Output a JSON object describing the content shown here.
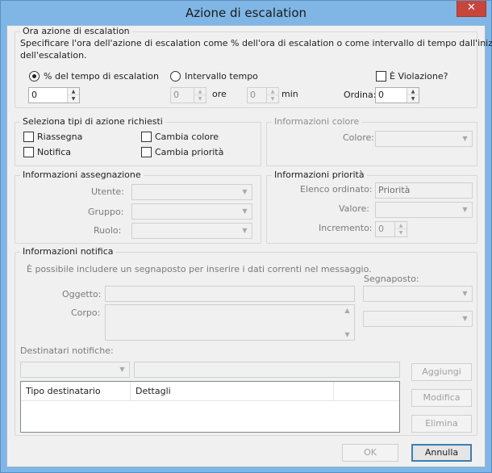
{
  "window": {
    "title": "Azione di escalation",
    "close_glyph": "✕"
  },
  "escalation_time": {
    "group_title": "Ora azione di escalation",
    "description_line1": "Specificare l'ora dell'azione di escalation come % dell'ora di escalation o come intervallo di tempo dall'inizio",
    "description_line2": "dell'escalation.",
    "percent_option": "% del tempo di escalation",
    "interval_option": "Intervallo tempo",
    "percent_value": "0",
    "hours_value": "0",
    "hours_unit": "ore",
    "minutes_value": "0",
    "minutes_unit": "min",
    "violation_label": "È Violazione?",
    "order_label": "Ordina:",
    "order_value": "0"
  },
  "action_types": {
    "group_title": "Seleziona tipi di azione richiesti",
    "reassign": "Riassegna",
    "notify": "Notifica",
    "change_color": "Cambia colore",
    "change_priority": "Cambia priorità"
  },
  "color_info": {
    "group_title": "Informazioni colore",
    "color_label": "Colore:"
  },
  "assignment_info": {
    "group_title": "Informazioni assegnazione",
    "user_label": "Utente:",
    "group_label": "Gruppo:",
    "role_label": "Ruolo:"
  },
  "priority_info": {
    "group_title": "Informazioni priorità",
    "ordered_list_label": "Elenco ordinato:",
    "ordered_list_value": "Priorità",
    "value_label": "Valore:",
    "increment_label": "Incremento:",
    "increment_value": "0"
  },
  "notification_info": {
    "group_title": "Informazioni notifica",
    "hint": "È possibile includere un segnaposto per inserire i dati correnti nel messaggio.",
    "placeholder_label": "Segnaposto:",
    "subject_label": "Oggetto:",
    "body_label": "Corpo:",
    "recipients_label": "Destinatari notifiche:",
    "add_button": "Aggiungi",
    "edit_button": "Modifica",
    "delete_button": "Elimina",
    "columns": [
      "Tipo destinatario",
      "Dettagli"
    ]
  },
  "footer": {
    "ok_button": "OK",
    "cancel_button": "Annulla"
  }
}
